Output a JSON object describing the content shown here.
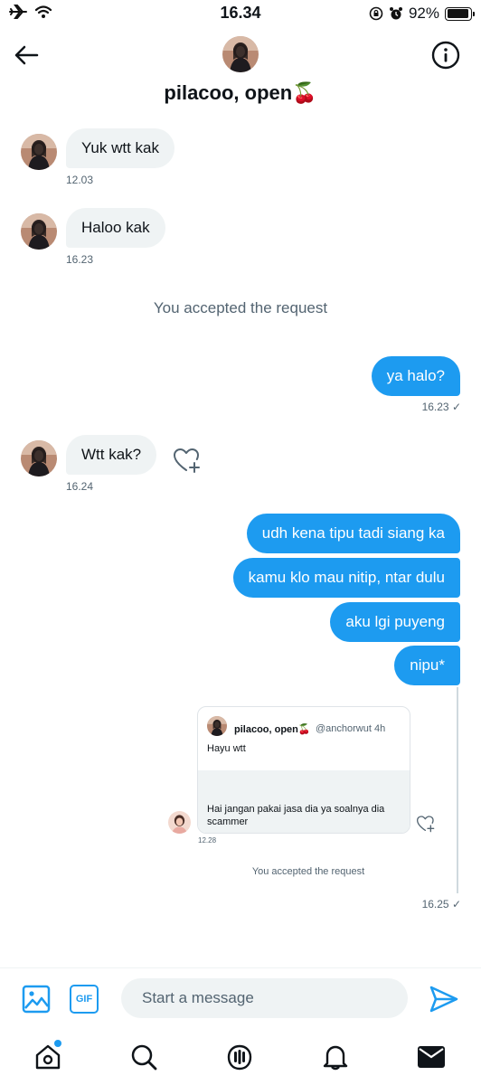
{
  "status_bar": {
    "time": "16.34",
    "battery": "92%",
    "battery_level": 0.92
  },
  "header": {
    "contact_name": "pilacoo, open🍒",
    "back_icon": "arrow-left-icon",
    "info_icon": "info-circle-icon"
  },
  "messages": {
    "m1": {
      "text": "Yuk wtt kak",
      "time": "12.03"
    },
    "m2": {
      "text": "Haloo kak",
      "time": "16.23"
    },
    "system1": "You accepted the request",
    "m3": {
      "text": "ya halo?",
      "time": "16.23 ✓"
    },
    "m4": {
      "text": "Wtt kak?",
      "time": "16.24"
    },
    "m5": {
      "text": "udh kena tipu tadi siang ka"
    },
    "m6": {
      "text": "kamu klo mau nitip, ntar dulu"
    },
    "m7": {
      "text": "aku lgi puyeng"
    },
    "m8": {
      "text": "nipu*"
    },
    "embed": {
      "name": "pilacoo, open🍒",
      "handle": "@anchorwut  4h",
      "text": "Hayu wtt",
      "reply": "Hai jangan pakai jasa dia ya soalnya dia scammer",
      "reply_time": "12.28",
      "system": "You accepted the request"
    },
    "embed_time": "16.25 ✓"
  },
  "composer": {
    "placeholder": "Start a message",
    "gif_label": "GIF"
  },
  "colors": {
    "accent": "#1d9bf0",
    "bubble_incoming": "#eff3f4",
    "muted_text": "#536471"
  },
  "nav": [
    "home-icon",
    "search-icon",
    "spaces-icon",
    "bell-icon",
    "mail-icon"
  ]
}
